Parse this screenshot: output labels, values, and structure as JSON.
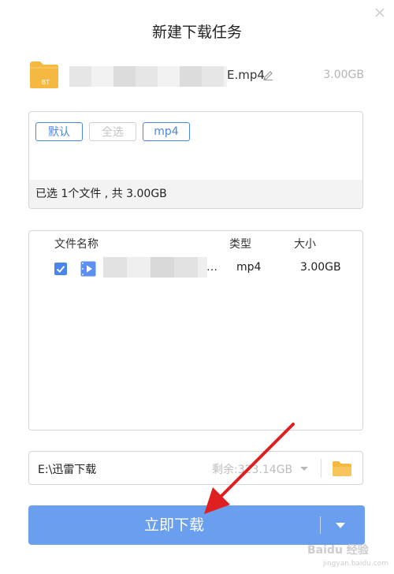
{
  "dialog": {
    "title": "新建下载任务"
  },
  "file": {
    "name_suffix": "E.mp4",
    "size": "3.00GB",
    "folder_badge": "BT"
  },
  "filters": {
    "default": "默认",
    "select_all": "全选",
    "mp4": "mp4"
  },
  "summary": "已选 1个文件 , 共 3.00GB",
  "list": {
    "headers": {
      "name": "文件名称",
      "type": "类型",
      "size": "大小"
    },
    "rows": [
      {
        "ellipsis": "…",
        "type": "mp4",
        "size": "3.00GB"
      }
    ]
  },
  "path": {
    "value": "E:\\迅雷下载",
    "free_space": "剩余:323.14GB"
  },
  "download": {
    "label": "立即下载"
  },
  "watermark": {
    "text": "Baidu 经验",
    "url": "jingyan.baidu.com"
  },
  "colors": {
    "accent": "#4a86e8",
    "button": "#6a9ff0",
    "arrow": "#e02020",
    "folder": "#f5b942"
  }
}
